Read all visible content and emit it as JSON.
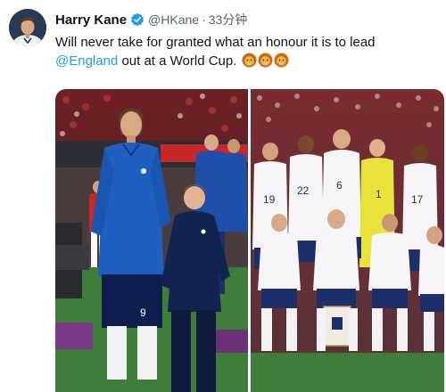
{
  "tweet": {
    "author": {
      "display_name": "Harry Kane",
      "handle": "@HKane",
      "verified": true
    },
    "separator": "·",
    "timestamp": "33分钟",
    "text": {
      "part1": "Will never take for granted what an honour it is to lead ",
      "mention": "@England",
      "part2": " out at a World Cup."
    },
    "emojis": [
      "lion-face-icon",
      "lion-face-icon",
      "lion-face-icon"
    ],
    "media": {
      "photo_count": 2
    }
  },
  "colors": {
    "link": "#1d9bf0",
    "text": "#0f1419",
    "muted": "#536471",
    "verified": "#1d9bf0",
    "pitch": "#3f7d3a",
    "england_navy": "#1c2f6b"
  }
}
